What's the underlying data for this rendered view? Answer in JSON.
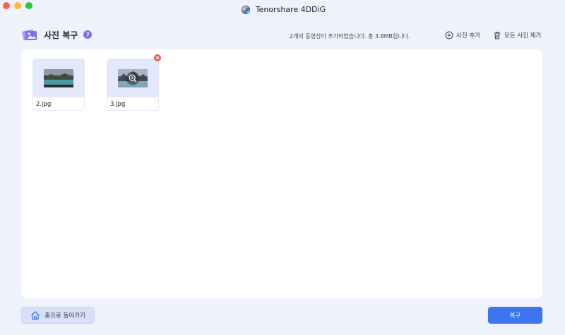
{
  "window": {
    "title": "Tenorshare 4DDiG"
  },
  "header": {
    "title": "사진 복구",
    "help_label": "?",
    "status": "2개의 동영상이 추가되었습니다. 총 3.8MB입니다.",
    "add_photo_label": "사진 추가",
    "remove_all_label": "모든 사진 제거"
  },
  "files": [
    {
      "name": "2.jpg"
    },
    {
      "name": "3.jpg"
    }
  ],
  "footer": {
    "home_label": "홈으로 돌아가기",
    "recover_label": "복구"
  },
  "colors": {
    "accent": "#3d75ee",
    "background": "#eef2fb",
    "remove_badge": "#ef5b4a",
    "help_badge": "#7c6ff0"
  }
}
